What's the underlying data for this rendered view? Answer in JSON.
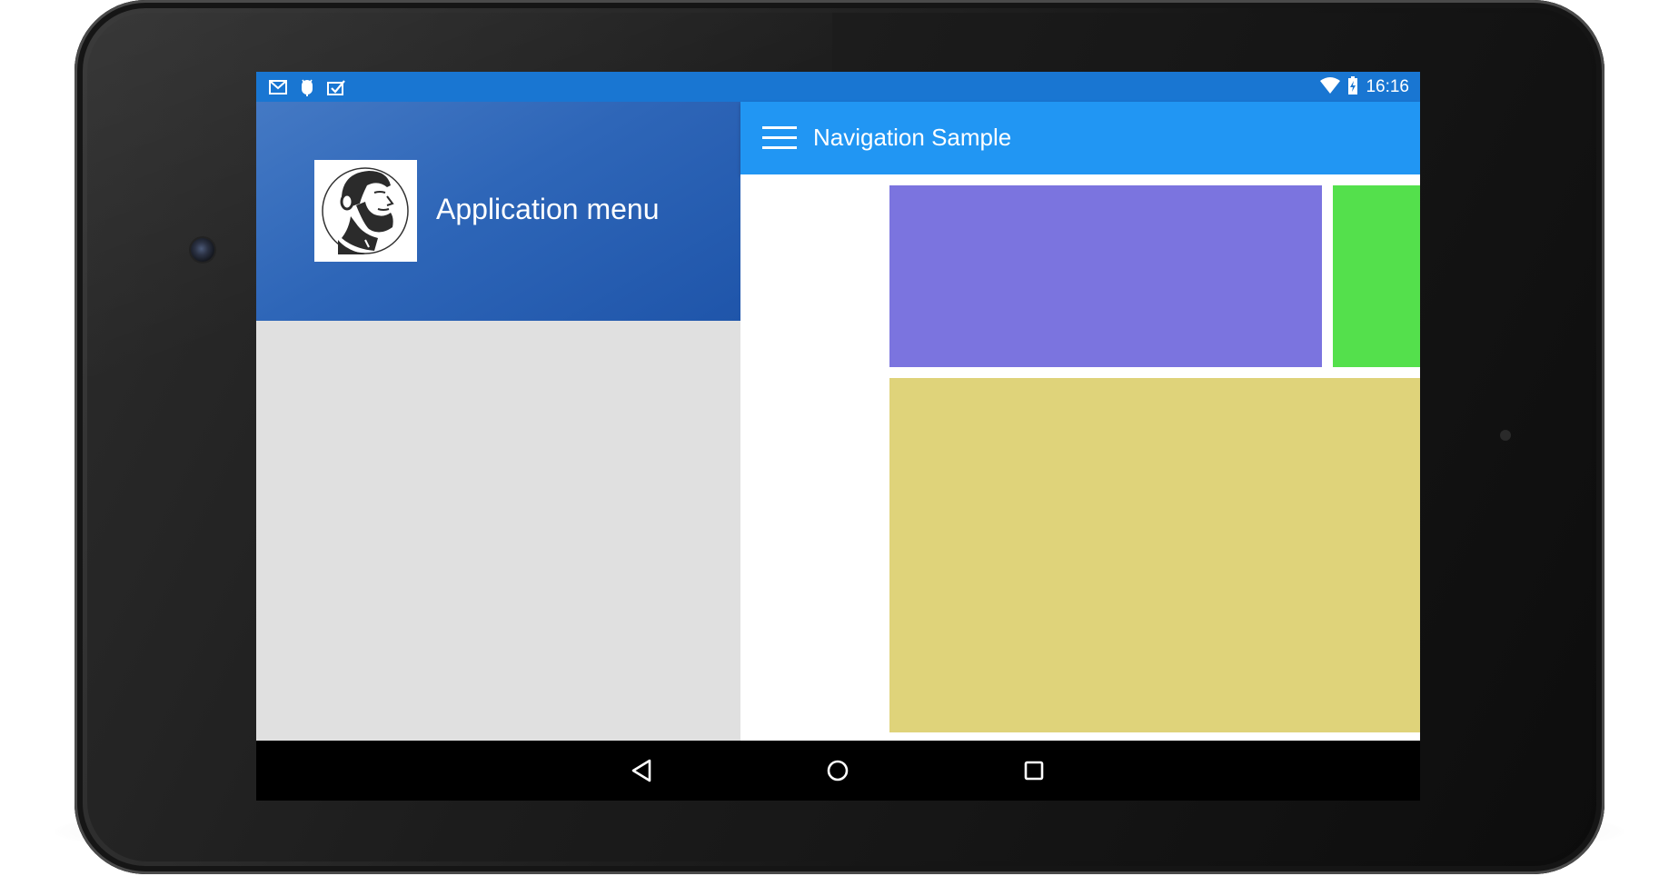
{
  "status_bar": {
    "time": "16:16",
    "notification_icons": [
      "gmail-icon",
      "android-debug-icon",
      "task-check-icon"
    ],
    "system_icons": [
      "wifi-icon",
      "battery-charging-icon"
    ],
    "color": "#1976d2"
  },
  "drawer": {
    "header_title": "Application menu",
    "avatar_icon": "bearded-man-avatar",
    "header_color": "#2e66b8",
    "background_color": "#e0e0e0"
  },
  "app_bar": {
    "title": "Navigation Sample",
    "menu_icon": "hamburger-menu-icon",
    "color": "#2196f3"
  },
  "content_blocks": [
    {
      "name": "purple-block",
      "color": "#7b74df"
    },
    {
      "name": "green-block",
      "color": "#54e04c"
    },
    {
      "name": "yellow-block",
      "color": "#dfd37a"
    }
  ],
  "navigation_bar": {
    "buttons": [
      "back-icon",
      "home-icon",
      "recents-icon"
    ]
  }
}
